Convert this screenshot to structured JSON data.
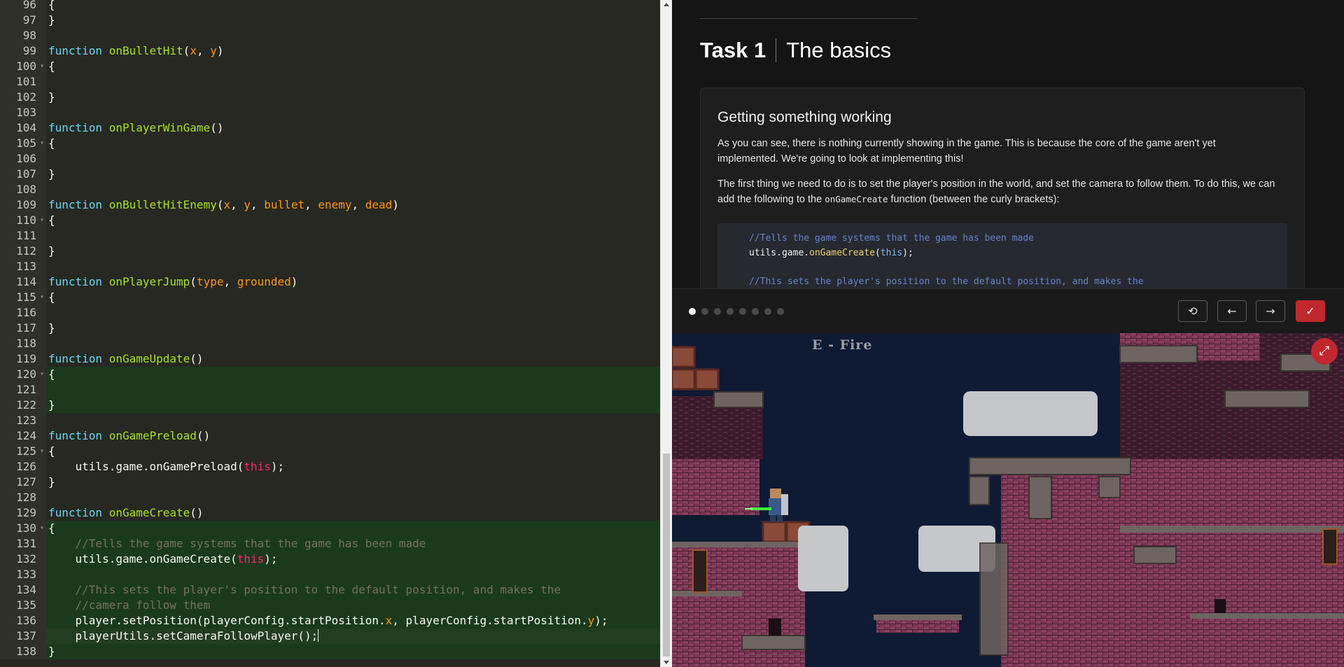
{
  "editor": {
    "lines": [
      {
        "n": "96",
        "fold": false,
        "hl": "",
        "tokens": [
          [
            "t",
            "{"
          ]
        ]
      },
      {
        "n": "97",
        "fold": false,
        "hl": "",
        "tokens": [
          [
            "t",
            "}"
          ]
        ]
      },
      {
        "n": "98",
        "fold": false,
        "hl": "",
        "tokens": []
      },
      {
        "n": "99",
        "fold": false,
        "hl": "",
        "tokens": [
          [
            "kw",
            "function"
          ],
          [
            "t",
            " "
          ],
          [
            "fn",
            "onBulletHit"
          ],
          [
            "t",
            "("
          ],
          [
            "pa",
            "x"
          ],
          [
            "t",
            ", "
          ],
          [
            "pa",
            "y"
          ],
          [
            "t",
            ")"
          ]
        ]
      },
      {
        "n": "100",
        "fold": true,
        "hl": "",
        "tokens": [
          [
            "t",
            "{"
          ]
        ]
      },
      {
        "n": "101",
        "fold": false,
        "hl": "",
        "tokens": []
      },
      {
        "n": "102",
        "fold": false,
        "hl": "",
        "tokens": [
          [
            "t",
            "}"
          ]
        ]
      },
      {
        "n": "103",
        "fold": false,
        "hl": "",
        "tokens": []
      },
      {
        "n": "104",
        "fold": false,
        "hl": "",
        "tokens": [
          [
            "kw",
            "function"
          ],
          [
            "t",
            " "
          ],
          [
            "fn",
            "onPlayerWinGame"
          ],
          [
            "t",
            "()"
          ]
        ]
      },
      {
        "n": "105",
        "fold": true,
        "hl": "",
        "tokens": [
          [
            "t",
            "{"
          ]
        ]
      },
      {
        "n": "106",
        "fold": false,
        "hl": "",
        "tokens": []
      },
      {
        "n": "107",
        "fold": false,
        "hl": "",
        "tokens": [
          [
            "t",
            "}"
          ]
        ]
      },
      {
        "n": "108",
        "fold": false,
        "hl": "",
        "tokens": []
      },
      {
        "n": "109",
        "fold": false,
        "hl": "",
        "tokens": [
          [
            "kw",
            "function"
          ],
          [
            "t",
            " "
          ],
          [
            "fn",
            "onBulletHitEnemy"
          ],
          [
            "t",
            "("
          ],
          [
            "pa",
            "x"
          ],
          [
            "t",
            ", "
          ],
          [
            "pa",
            "y"
          ],
          [
            "t",
            ", "
          ],
          [
            "pa",
            "bullet"
          ],
          [
            "t",
            ", "
          ],
          [
            "pa",
            "enemy"
          ],
          [
            "t",
            ", "
          ],
          [
            "pa",
            "dead"
          ],
          [
            "t",
            ")"
          ]
        ]
      },
      {
        "n": "110",
        "fold": true,
        "hl": "",
        "tokens": [
          [
            "t",
            "{"
          ]
        ]
      },
      {
        "n": "111",
        "fold": false,
        "hl": "",
        "tokens": []
      },
      {
        "n": "112",
        "fold": false,
        "hl": "",
        "tokens": [
          [
            "t",
            "}"
          ]
        ]
      },
      {
        "n": "113",
        "fold": false,
        "hl": "",
        "tokens": []
      },
      {
        "n": "114",
        "fold": false,
        "hl": "",
        "tokens": [
          [
            "kw",
            "function"
          ],
          [
            "t",
            " "
          ],
          [
            "fn",
            "onPlayerJump"
          ],
          [
            "t",
            "("
          ],
          [
            "pa",
            "type"
          ],
          [
            "t",
            ", "
          ],
          [
            "pa",
            "grounded"
          ],
          [
            "t",
            ")"
          ]
        ]
      },
      {
        "n": "115",
        "fold": true,
        "hl": "",
        "tokens": [
          [
            "t",
            "{"
          ]
        ]
      },
      {
        "n": "116",
        "fold": false,
        "hl": "",
        "tokens": []
      },
      {
        "n": "117",
        "fold": false,
        "hl": "",
        "tokens": [
          [
            "t",
            "}"
          ]
        ]
      },
      {
        "n": "118",
        "fold": false,
        "hl": "",
        "tokens": []
      },
      {
        "n": "119",
        "fold": false,
        "hl": "",
        "tokens": [
          [
            "kw",
            "function"
          ],
          [
            "t",
            " "
          ],
          [
            "fn",
            "onGameUpdate"
          ],
          [
            "t",
            "()"
          ]
        ]
      },
      {
        "n": "120",
        "fold": true,
        "hl": "hl",
        "tokens": [
          [
            "t",
            "{"
          ]
        ]
      },
      {
        "n": "121",
        "fold": false,
        "hl": "hl",
        "tokens": []
      },
      {
        "n": "122",
        "fold": false,
        "hl": "hl",
        "tokens": [
          [
            "t",
            "}"
          ]
        ]
      },
      {
        "n": "123",
        "fold": false,
        "hl": "",
        "tokens": []
      },
      {
        "n": "124",
        "fold": false,
        "hl": "",
        "tokens": [
          [
            "kw",
            "function"
          ],
          [
            "t",
            " "
          ],
          [
            "fn",
            "onGamePreload"
          ],
          [
            "t",
            "()"
          ]
        ]
      },
      {
        "n": "125",
        "fold": true,
        "hl": "",
        "tokens": [
          [
            "t",
            "{"
          ]
        ]
      },
      {
        "n": "126",
        "fold": false,
        "hl": "",
        "tokens": [
          [
            "t",
            "    utils.game.onGamePreload("
          ],
          [
            "th",
            "this"
          ],
          [
            "t",
            ");"
          ]
        ]
      },
      {
        "n": "127",
        "fold": false,
        "hl": "",
        "tokens": [
          [
            "t",
            "}"
          ]
        ]
      },
      {
        "n": "128",
        "fold": false,
        "hl": "",
        "tokens": []
      },
      {
        "n": "129",
        "fold": false,
        "hl": "",
        "tokens": [
          [
            "kw",
            "function"
          ],
          [
            "t",
            " "
          ],
          [
            "fn",
            "onGameCreate"
          ],
          [
            "t",
            "()"
          ]
        ]
      },
      {
        "n": "130",
        "fold": true,
        "hl": "hl",
        "tokens": [
          [
            "t",
            "{"
          ]
        ]
      },
      {
        "n": "131",
        "fold": false,
        "hl": "hl",
        "tokens": [
          [
            "cm",
            "    //Tells the game systems that the game has been made"
          ]
        ]
      },
      {
        "n": "132",
        "fold": false,
        "hl": "hl",
        "tokens": [
          [
            "t",
            "    utils.game.onGameCreate("
          ],
          [
            "th",
            "this"
          ],
          [
            "t",
            ");"
          ]
        ]
      },
      {
        "n": "133",
        "fold": false,
        "hl": "hl",
        "tokens": []
      },
      {
        "n": "134",
        "fold": false,
        "hl": "hl",
        "tokens": [
          [
            "cm",
            "    //This sets the player's position to the default position, and makes the"
          ]
        ]
      },
      {
        "n": "135",
        "fold": false,
        "hl": "hl",
        "tokens": [
          [
            "cm",
            "    //camera follow them"
          ]
        ]
      },
      {
        "n": "136",
        "fold": false,
        "hl": "hl",
        "tokens": [
          [
            "t",
            "    player.setPosition(playerConfig.startPosition."
          ],
          [
            "pa",
            "x"
          ],
          [
            "t",
            ", playerConfig.startPosition."
          ],
          [
            "pa",
            "y"
          ],
          [
            "t",
            ");"
          ]
        ]
      },
      {
        "n": "137",
        "fold": false,
        "hl": "cur",
        "tokens": [
          [
            "t",
            "    playerUtils.setCameraFollowPlayer();"
          ],
          [
            "caret",
            ""
          ]
        ]
      },
      {
        "n": "138",
        "fold": false,
        "hl": "hl",
        "tokens": [
          [
            "t",
            "}"
          ]
        ]
      }
    ],
    "scroll_fraction": 0.69
  },
  "task": {
    "number": "Task 1",
    "name": "The basics",
    "heading": "Getting something working",
    "para1": "As you can see, there is nothing currently showing in the game. This is because the core of the game aren't yet implemented. We're going to look at implementing this!",
    "para2_before": "The first thing we need to do is to set the player's position in the world, and set the camera to follow them. To do this, we can add the following to the ",
    "para2_code": "onGameCreate",
    "para2_after": " function (between the curly brackets):",
    "sample": {
      "comment1": "//Tells the game systems that the game has been made",
      "line2_a": "utils.game.",
      "line2_fn": "onGameCreate",
      "line2_b": "(",
      "line2_this": "this",
      "line2_c": ");",
      "comment2": "//This sets the player's position to the default position, and makes the"
    }
  },
  "controls": {
    "page_count": 8,
    "current_page": 1,
    "reset_icon": "history-icon",
    "prev_icon": "arrow-left-icon",
    "next_icon": "arrow-right-icon",
    "complete_icon": "check-icon",
    "reset_glyph": "⟲",
    "prev_glyph": "←",
    "next_glyph": "→",
    "complete_glyph": "✓"
  },
  "game": {
    "hint_text": "E - Fire",
    "fullscreen_glyph": "⤢",
    "fullscreen_icon": "expand-icon"
  },
  "colors": {
    "highlight": "#1b3a1d",
    "accent_red": "#c0282d",
    "game_sky": "#0f1a35"
  }
}
